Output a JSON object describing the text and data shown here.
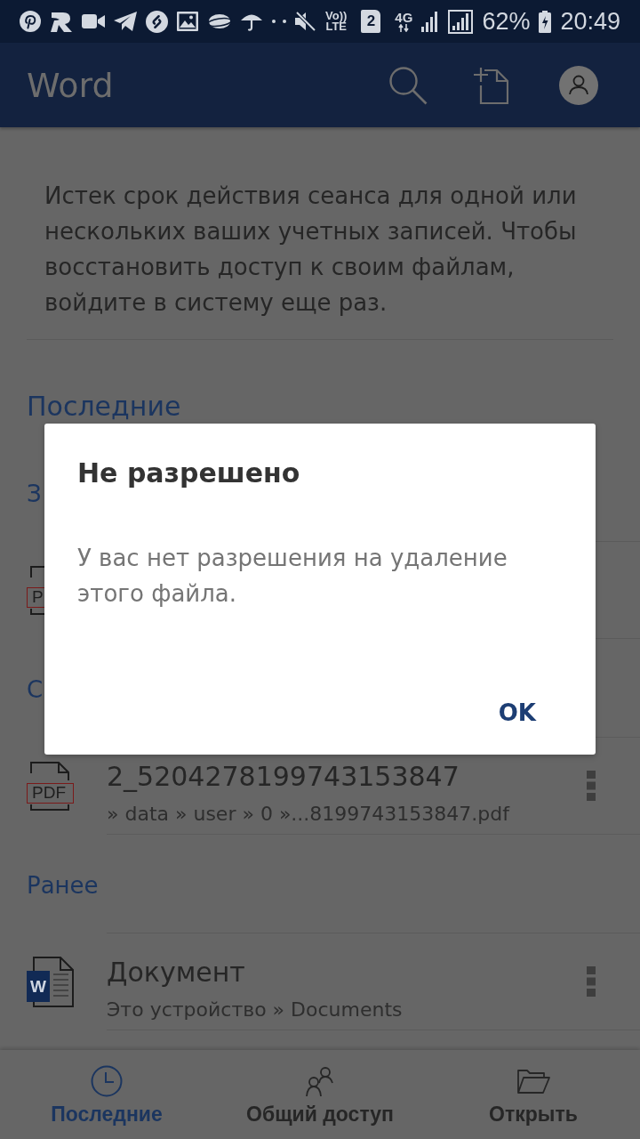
{
  "status_bar": {
    "volte_top": "Vo))",
    "volte_bottom": "LTE",
    "sim": "2",
    "network": "4G",
    "battery": "62%",
    "time": "20:49"
  },
  "app_bar": {
    "title": "Word"
  },
  "notice": {
    "text": "Истек срок действия сеанса для одной или нескольких ваших учетных записей. Чтобы восстановить доступ к своим файлам, войдите в систему еще раз."
  },
  "recent": {
    "heading": "Последние",
    "groups": [
      {
        "label": "З",
        "files": [
          {
            "kind": "pdf",
            "badge": "P"
          }
        ]
      },
      {
        "label": "С",
        "files": [
          {
            "kind": "pdf",
            "badge": "PDF",
            "name": "2_5204278199743153847",
            "path": "» data » user » 0 »...8199743153847.pdf"
          }
        ]
      },
      {
        "label": "Ранее",
        "files": [
          {
            "kind": "word",
            "badge": "W",
            "name": "Документ",
            "path": "Это устройство » Documents"
          }
        ]
      }
    ]
  },
  "bottom_nav": [
    {
      "kind": "recent",
      "label": "Последние",
      "selected": true
    },
    {
      "kind": "shared",
      "label": "Общий доступ",
      "selected": false
    },
    {
      "kind": "open",
      "label": "Открыть",
      "selected": false
    }
  ],
  "dialog": {
    "title": "Не разрешено",
    "message": "У вас нет разрешения на удаление этого файла.",
    "button": "OK"
  }
}
